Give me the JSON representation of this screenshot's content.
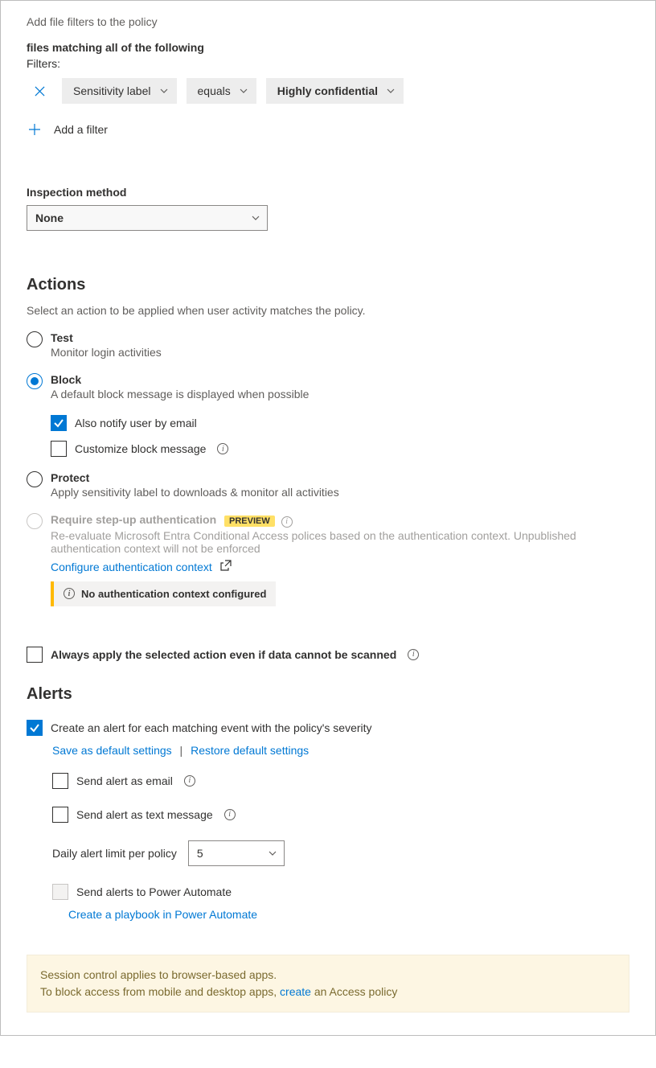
{
  "filters": {
    "heading": "Add file filters to the policy",
    "matching": "files matching all of the following",
    "label": "Filters:",
    "field": "Sensitivity label",
    "operator": "equals",
    "value": "Highly confidential",
    "add": "Add a filter"
  },
  "inspection": {
    "label": "Inspection method",
    "value": "None"
  },
  "actions": {
    "title": "Actions",
    "desc": "Select an action to be applied when user activity matches the policy.",
    "test": {
      "title": "Test",
      "desc": "Monitor login activities"
    },
    "block": {
      "title": "Block",
      "desc": "A default block message is displayed when possible",
      "notify": "Also notify user by email",
      "customize": "Customize block message"
    },
    "protect": {
      "title": "Protect",
      "desc": "Apply sensitivity label to downloads & monitor all activities"
    },
    "stepup": {
      "title": "Require step-up authentication",
      "badge": "PREVIEW",
      "desc": "Re-evaluate Microsoft Entra Conditional Access polices based on the authentication context. Unpublished authentication context will not be enforced",
      "link": "Configure authentication context",
      "warn": "No authentication context configured"
    },
    "always": "Always apply the selected action even if data cannot be scanned"
  },
  "alerts": {
    "title": "Alerts",
    "create": "Create an alert for each matching event with the policy's severity",
    "save": "Save as default settings",
    "restore": "Restore default settings",
    "email": "Send alert as email",
    "text": "Send alert as text message",
    "limitLabel": "Daily alert limit per policy",
    "limitValue": "5",
    "pa": "Send alerts to Power Automate",
    "paLink": "Create a playbook in Power Automate"
  },
  "footer": {
    "line1": "Session control applies to browser-based apps.",
    "line2a": "To block access from mobile and desktop apps, ",
    "link": "create",
    "line2b": " an Access policy"
  }
}
